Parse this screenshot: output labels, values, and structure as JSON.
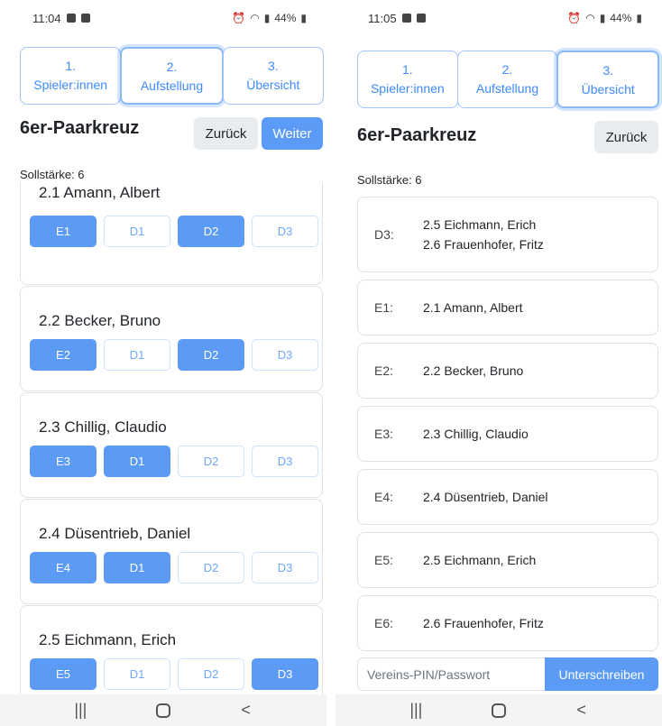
{
  "left": {
    "status": {
      "time": "11:04",
      "battery": "44%"
    },
    "steps": [
      {
        "num": "1.",
        "label": "Spieler:innen"
      },
      {
        "num": "2.",
        "label": "Aufstellung"
      },
      {
        "num": "3.",
        "label": "Übersicht"
      }
    ],
    "title": "6er-Paarkreuz",
    "subtitle": "Sollstärke: 6",
    "back_label": "Zurück",
    "next_label": "Weiter",
    "players": [
      {
        "name": "2.1 Amann, Albert",
        "chips": [
          {
            "label": "E1",
            "on": true
          },
          {
            "label": "D1",
            "on": false
          },
          {
            "label": "D2",
            "on": true
          },
          {
            "label": "D3",
            "on": false
          }
        ]
      },
      {
        "name": "2.2 Becker, Bruno",
        "chips": [
          {
            "label": "E2",
            "on": true
          },
          {
            "label": "D1",
            "on": false
          },
          {
            "label": "D2",
            "on": true
          },
          {
            "label": "D3",
            "on": false
          }
        ]
      },
      {
        "name": "2.3 Chillig, Claudio",
        "chips": [
          {
            "label": "E3",
            "on": true
          },
          {
            "label": "D1",
            "on": true
          },
          {
            "label": "D2",
            "on": false
          },
          {
            "label": "D3",
            "on": false
          }
        ]
      },
      {
        "name": "2.4 Düsentrieb, Daniel",
        "chips": [
          {
            "label": "E4",
            "on": true
          },
          {
            "label": "D1",
            "on": true
          },
          {
            "label": "D2",
            "on": false
          },
          {
            "label": "D3",
            "on": false
          }
        ]
      },
      {
        "name": "2.5 Eichmann, Erich",
        "chips": [
          {
            "label": "E5",
            "on": true
          },
          {
            "label": "D1",
            "on": false
          },
          {
            "label": "D2",
            "on": false
          },
          {
            "label": "D3",
            "on": true
          }
        ]
      }
    ]
  },
  "right": {
    "status": {
      "time": "11:05",
      "battery": "44%"
    },
    "steps": [
      {
        "num": "1.",
        "label": "Spieler:innen"
      },
      {
        "num": "2.",
        "label": "Aufstellung"
      },
      {
        "num": "3.",
        "label": "Übersicht"
      }
    ],
    "title": "6er-Paarkreuz",
    "subtitle": "Sollstärke: 6",
    "back_label": "Zurück",
    "overview": [
      {
        "code": "D3:",
        "line1": "2.5 Eichmann, Erich",
        "line2": "2.6 Frauenhofer, Fritz"
      },
      {
        "code": "E1:",
        "line1": "2.1 Amann, Albert"
      },
      {
        "code": "E2:",
        "line1": "2.2 Becker, Bruno"
      },
      {
        "code": "E3:",
        "line1": "2.3 Chillig, Claudio"
      },
      {
        "code": "E4:",
        "line1": "2.4 Düsentrieb, Daniel"
      },
      {
        "code": "E5:",
        "line1": "2.5 Eichmann, Erich"
      },
      {
        "code": "E6:",
        "line1": "2.6 Frauenhofer, Fritz"
      }
    ],
    "pin_placeholder": "Vereins-PIN/Passwort",
    "sign_label": "Unterschreiben"
  },
  "nav": {
    "recents": "|||",
    "back": "<"
  },
  "icons": {
    "status_left": [
      "image-icon",
      "check-box-icon"
    ],
    "status_right": [
      "alarm-icon",
      "wifi-icon",
      "signal-icon",
      "battery-icon"
    ]
  }
}
